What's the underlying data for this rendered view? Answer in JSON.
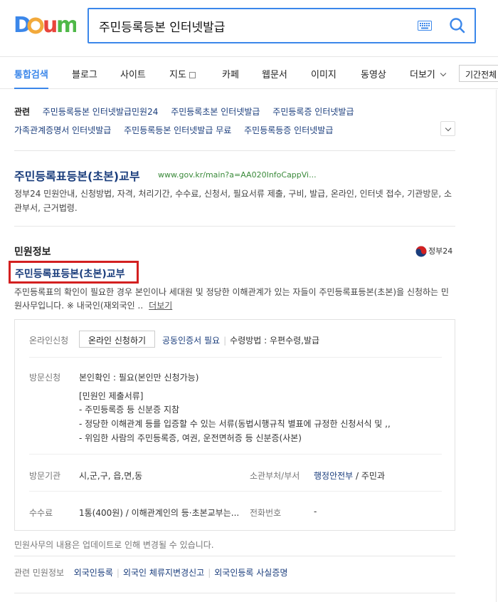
{
  "search": {
    "query": "주민등록등본 인터넷발급"
  },
  "tabs": [
    {
      "label": "통합검색"
    },
    {
      "label": "블로그"
    },
    {
      "label": "사이트"
    },
    {
      "label": "지도"
    },
    {
      "label": "카페"
    },
    {
      "label": "웹문서"
    },
    {
      "label": "이미지"
    },
    {
      "label": "동영상"
    },
    {
      "label": "더보기"
    }
  ],
  "period_filter": "기간전체",
  "related": {
    "label": "관련",
    "row1": [
      "주민등록등본 인터넷발급민원24",
      "주민등록초본 인터넷발급",
      "주민등록증 인터넷발급"
    ],
    "row2": [
      "가족관계증명서 인터넷발급",
      "주민등록등본 인터넷발급 무료",
      "주민등록등증 인터넷발급"
    ]
  },
  "result1": {
    "title": "주민등록표등본(초본)교부",
    "url": "www.gov.kr/main?a=AA020InfoCappVi...",
    "desc": "정부24 민원안내, 신청방법, 자격, 처리기간, 수수료, 신청서, 필요서류 제출, 구비, 발급, 온라인, 인터넷 접수, 기관방문, 소관부서, 근거법령."
  },
  "minwon": {
    "heading": "민원정보",
    "gov_label": "정부24",
    "title": "주민등록표등본(초본)교부",
    "desc": "주민등록표의 확인이 필요한 경우 본인이나 세대원 및 정당한 이해관계가 있는 자들이 주민등록표등본(초본)을 신청하는 민원사무입니다. ※ 내국인(재외국인 ..",
    "more_label": "더보기",
    "online_label": "온라인신청",
    "online_button": "온라인 신청하기",
    "cert_required": "공동인증서 필요",
    "receive_method": "수령방법 : 우편수령,발급",
    "visit_label": "방문신청",
    "visit_lines": [
      "본인확인 : 필요(본인만 신청가능)",
      "[민원인 제출서류]",
      "- 주민등록증 등 신분증 지참",
      "- 정당한 이해관계 등를 입증할 수 있는 서류(동법시행규칙 별표에 규정한 신청서식 및 ,,",
      "- 위임한 사람의 주민등록증, 여권, 운전면허증 등 신분증(사본)"
    ],
    "agency_label": "방문기관",
    "agency_value": "시,군,구, 읍,면,동",
    "dept_label": "소관부처/부서",
    "dept_link": "행정안전부",
    "dept_sub": " / 주민과",
    "fee_label": "수수료",
    "fee_value": "1통(400원) / 이해관계인의 등·초본교부는...",
    "phone_label": "전화번호",
    "phone_value": "-",
    "update_note": "민원사무의 내용은 업데이트로 인해 변경될 수 있습니다.",
    "related_label": "관련 민원정보",
    "related_links": [
      "외국인등록",
      "외국인 체류지변경신고",
      "외국인등록 사실증명"
    ]
  },
  "colors": {
    "brand_blue": "#3b87ea",
    "link_navy": "#1a3d7c",
    "url_green": "#3a8a3a",
    "highlight_red": "#d32020"
  }
}
